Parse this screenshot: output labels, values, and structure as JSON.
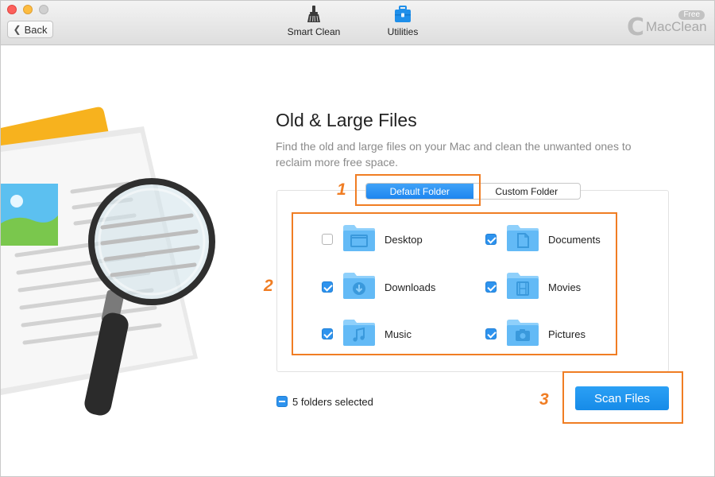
{
  "window": {
    "back_label": "Back"
  },
  "toolbar": {
    "tools": [
      {
        "label": "Smart Clean",
        "icon": "broom-icon"
      },
      {
        "label": "Utilities",
        "icon": "toolbox-icon"
      }
    ]
  },
  "brand": {
    "letter": "C",
    "name": "MacClean",
    "badge": "Free"
  },
  "main": {
    "title": "Old & Large Files",
    "subtitle": "Find the old and large files on your Mac and clean the unwanted ones to reclaim more free space.",
    "segments": [
      {
        "label": "Default Folder",
        "active": true
      },
      {
        "label": "Custom Folder",
        "active": false
      }
    ],
    "folders": [
      {
        "label": "Desktop",
        "checked": false,
        "icon": "desktop-folder-icon"
      },
      {
        "label": "Documents",
        "checked": true,
        "icon": "documents-folder-icon"
      },
      {
        "label": "Downloads",
        "checked": true,
        "icon": "downloads-folder-icon"
      },
      {
        "label": "Movies",
        "checked": true,
        "icon": "movies-folder-icon"
      },
      {
        "label": "Music",
        "checked": true,
        "icon": "music-folder-icon"
      },
      {
        "label": "Pictures",
        "checked": true,
        "icon": "pictures-folder-icon"
      }
    ],
    "selected_text": "5 folders selected",
    "scan_label": "Scan Files"
  },
  "callouts": {
    "step1": "1",
    "step2": "2",
    "step3": "3"
  },
  "colors": {
    "accent": "#2e93ee",
    "callout": "#f07d23"
  }
}
